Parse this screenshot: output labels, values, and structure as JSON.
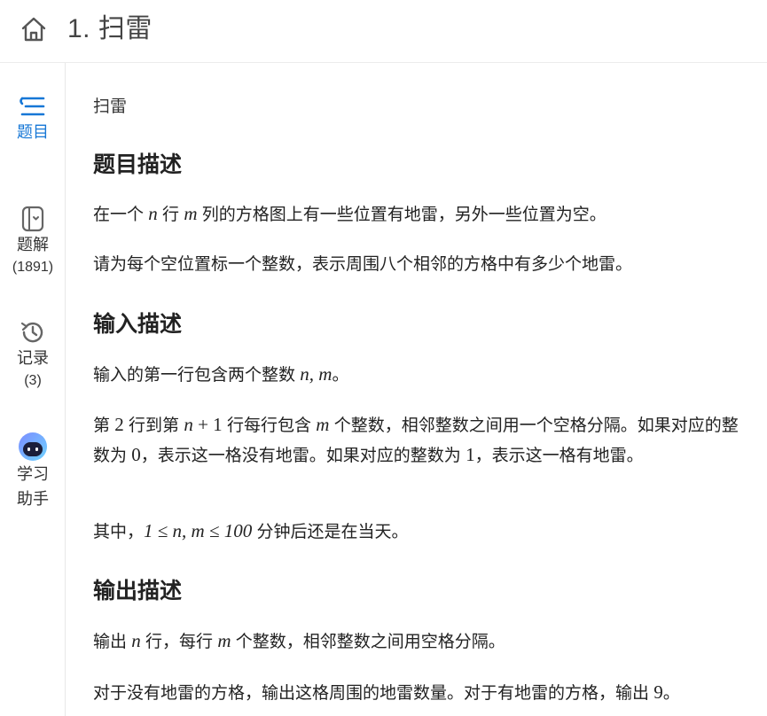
{
  "header": {
    "title": "1. 扫雷"
  },
  "sidebar": {
    "items": [
      {
        "label": "题目",
        "count": ""
      },
      {
        "label": "题解",
        "count": "(1891)"
      },
      {
        "label": "记录",
        "count": "(3)"
      },
      {
        "label": "学习助手",
        "line1": "学习",
        "line2": "助手"
      }
    ],
    "active_color": "#1677d6"
  },
  "problem": {
    "name": "扫雷",
    "sections": {
      "desc_title": "题目描述",
      "desc_p1": {
        "a": "在一个 ",
        "n": "n",
        "b": " 行 ",
        "m": "m",
        "c": " 列的方格图上有一些位置有地雷，另外一些位置为空。"
      },
      "desc_p2": "请为每个空位置标一个整数，表示周围八个相邻的方格中有多少个地雷。",
      "input_title": "输入描述",
      "input_p1": {
        "a": "输入的第一行包含两个整数 ",
        "expr": "n, m",
        "b": "。"
      },
      "input_p2": {
        "a": "第 ",
        "two": "2",
        "b": " 行到第 ",
        "n": "n",
        "plus": " + 1",
        "c": " 行每行包含 ",
        "m": "m",
        "d": " 个整数，相邻整数之间用一个空格分隔。如果对应的整数为 ",
        "zero": "0",
        "e": "，表示这一格没有地雷。如果对应的整数为 ",
        "one": "1",
        "f": "，表示这一格有地雷。"
      },
      "input_p3": {
        "a": "其中，",
        "expr": "1 ≤ n, m ≤ 100",
        "b": " 分钟后还是在当天。"
      },
      "output_title": "输出描述",
      "output_p1": {
        "a": "输出 ",
        "n": "n",
        "b": " 行，每行 ",
        "m": "m",
        "c": " 个整数，相邻整数之间用空格分隔。"
      },
      "output_p2": {
        "a": "对于没有地雷的方格，输出这格周围的地雷数量。对于有地雷的方格，输出 ",
        "nine": "9",
        "b": "。"
      }
    }
  },
  "icons": {
    "home": "home-icon",
    "problem": "list-icon",
    "solution": "book-icon",
    "record": "history-icon",
    "assistant": "robot-icon"
  }
}
